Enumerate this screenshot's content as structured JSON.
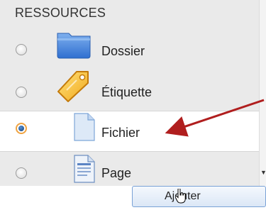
{
  "section_title": "RESSOURCES",
  "items": [
    {
      "label": "Dossier",
      "icon": "folder-icon",
      "checked": false
    },
    {
      "label": "Étiquette",
      "icon": "tag-icon",
      "checked": false
    },
    {
      "label": "Fichier",
      "icon": "file-icon",
      "checked": true
    },
    {
      "label": "Page",
      "icon": "page-icon",
      "checked": false
    }
  ],
  "add_button_label": "Ajouter",
  "colors": {
    "panel": "#eaeaea",
    "selected_row": "#ffffff",
    "radio_focus": "#f0a341",
    "annotation_arrow": "#b01e1e"
  }
}
